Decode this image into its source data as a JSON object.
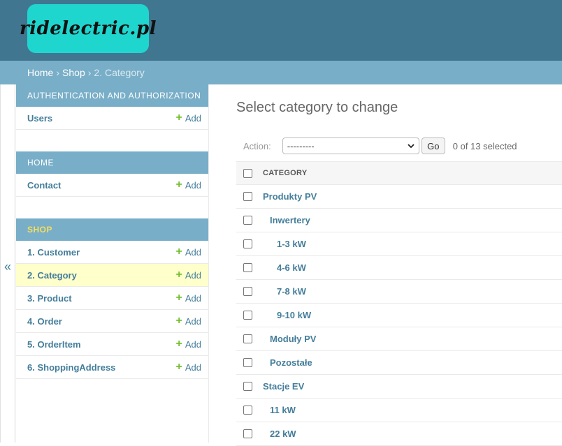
{
  "header": {
    "logo_text": "ridelectric.pl"
  },
  "breadcrumbs": {
    "home": "Home",
    "shop": "Shop",
    "current": "2. Category"
  },
  "nav_toggle": {
    "glyph": "«"
  },
  "sidebar": {
    "modules": [
      {
        "caption": "Authentication and Authorization",
        "active": false,
        "models": [
          {
            "name": "Users",
            "add": "Add"
          }
        ]
      },
      {
        "caption": "Home",
        "active": false,
        "models": [
          {
            "name": "Contact",
            "add": "Add"
          }
        ]
      },
      {
        "caption": "Shop",
        "active": true,
        "models": [
          {
            "name": "1. Customer",
            "add": "Add"
          },
          {
            "name": "2. Category",
            "add": "Add",
            "selected": true
          },
          {
            "name": "3. Product",
            "add": "Add"
          },
          {
            "name": "4. Order",
            "add": "Add"
          },
          {
            "name": "5. OrderItem",
            "add": "Add"
          },
          {
            "name": "6. ShoppingAddress",
            "add": "Add"
          }
        ]
      }
    ]
  },
  "content": {
    "title": "Select category to change",
    "actions": {
      "label": "Action:",
      "selected_option": "---------",
      "go_label": "Go",
      "selection_count": "0 of 13 selected"
    },
    "table": {
      "column_header": "CATEGORY",
      "rows": [
        {
          "name": "Produkty PV",
          "level": 0
        },
        {
          "name": "Inwertery",
          "level": 1
        },
        {
          "name": "1-3 kW",
          "level": 2
        },
        {
          "name": "4-6 kW",
          "level": 2
        },
        {
          "name": "7-8 kW",
          "level": 2
        },
        {
          "name": "9-10 kW",
          "level": 2
        },
        {
          "name": "Moduły PV",
          "level": 1
        },
        {
          "name": "Pozostałe",
          "level": 1
        },
        {
          "name": "Stacje EV",
          "level": 0
        },
        {
          "name": "11 kW",
          "level": 1
        },
        {
          "name": "22 kW",
          "level": 1
        }
      ]
    }
  },
  "colors": {
    "header_bg": "#417690",
    "breadcrumb_bg": "#79aec8",
    "link": "#447e9b",
    "add_plus": "#70bf2b",
    "selected_row": "#ffffcc",
    "logo_bg": "#1fd6cf",
    "active_caption": "#f5dd5d"
  },
  "icons": {
    "add": "plus-icon",
    "collapse": "double-chevron-left-icon",
    "select_arrow": "chevron-down-icon"
  }
}
